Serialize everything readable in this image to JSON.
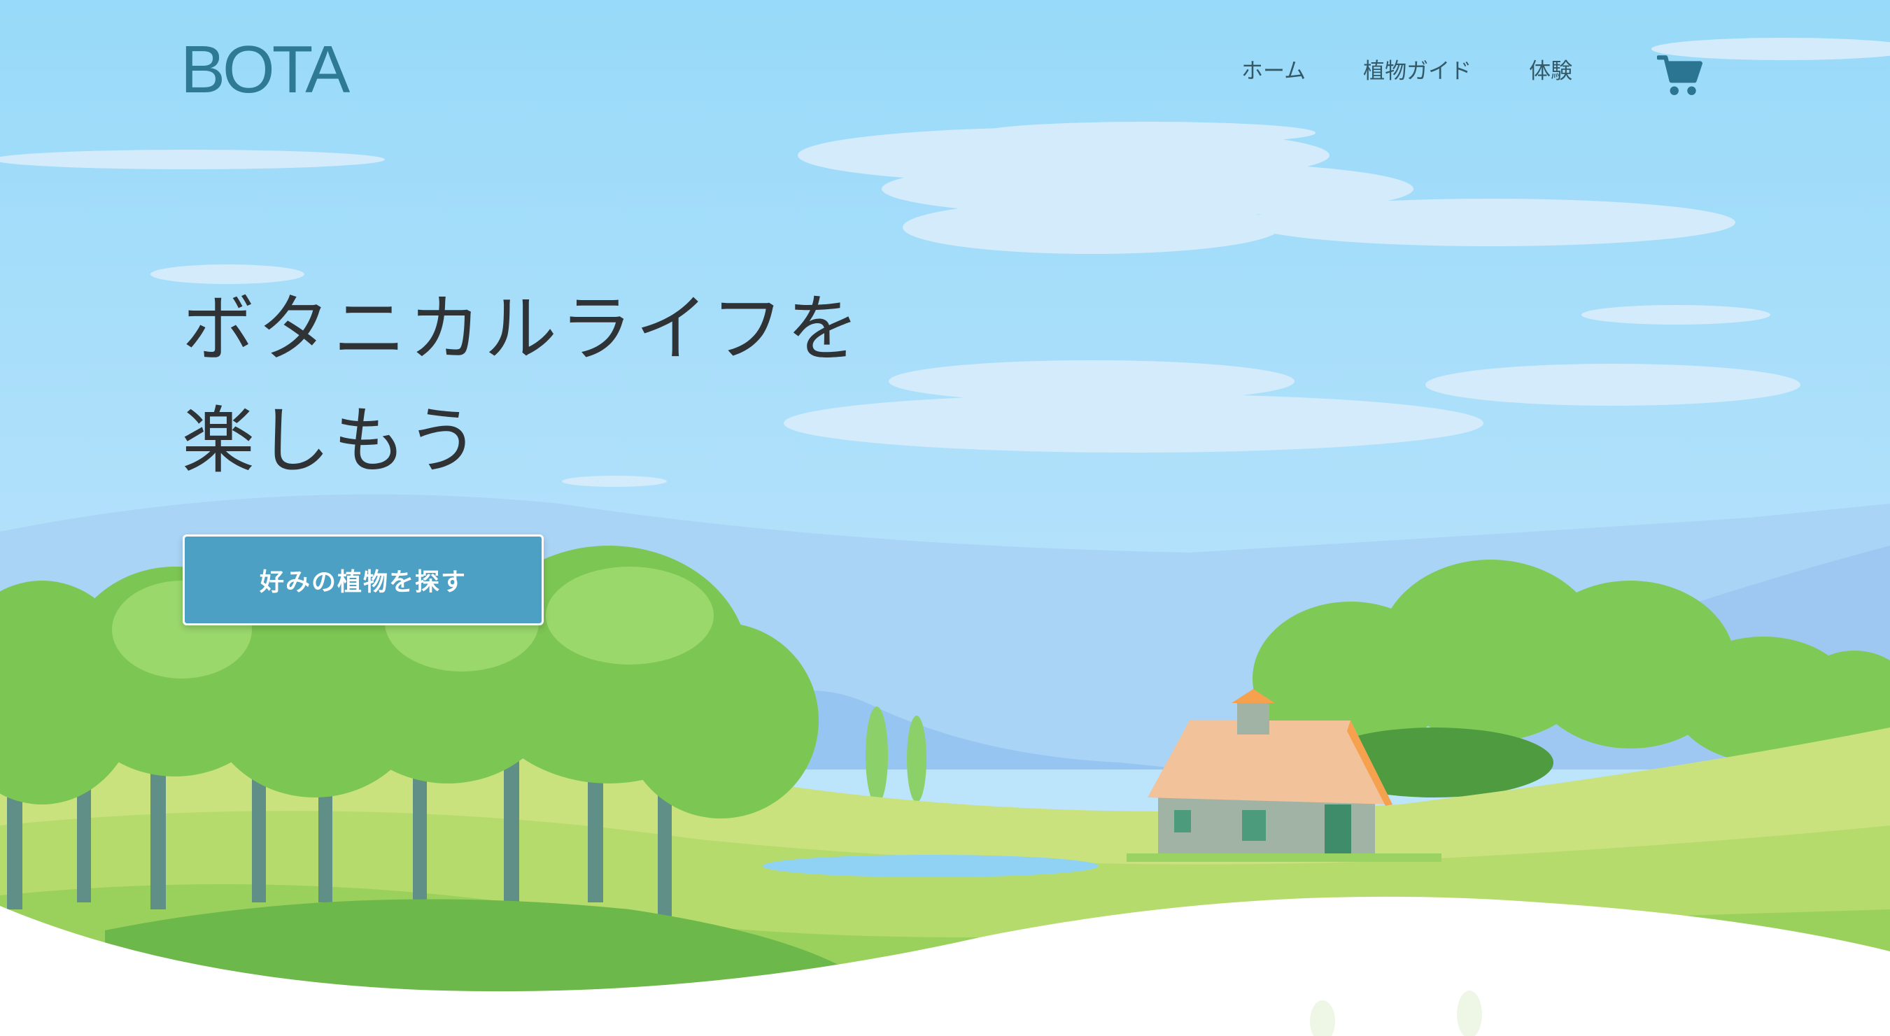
{
  "header": {
    "logo": "BOTA",
    "nav": [
      {
        "label": "ホーム"
      },
      {
        "label": "植物ガイド"
      },
      {
        "label": "体験"
      }
    ],
    "cart_icon": "shopping-cart-icon"
  },
  "hero": {
    "title_line1": "ボタニカルライフを",
    "title_line2": "楽しもう",
    "cta_label": "好みの植物を探す"
  },
  "colors": {
    "sky_top": "#9cdcf8",
    "sky_bottom": "#bfe3fa",
    "accent": "#4ba0c4",
    "logo": "#2e7a94",
    "nav_text": "#335866",
    "title_text": "#2f3336",
    "grass": "#8ccf5a",
    "tree_foliage": "#7cc653"
  }
}
